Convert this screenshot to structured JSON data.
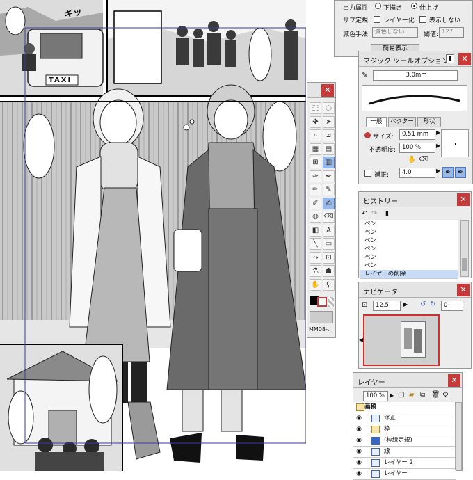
{
  "artboard": {
    "taxi_sign": "TAXI",
    "sfx": "キッ",
    "background_color": "#ffffff",
    "panel_border_color": "#000000",
    "guide_color": "#3a3aa8"
  },
  "property_panel": {
    "output_attr_label": "出力属性:",
    "output_draft": "下描き",
    "output_final": "仕上げ",
    "subtool_label": "サブ定規:",
    "layer_mode_label": "レイヤー化",
    "hide_label": "表示しない",
    "reduce_label": "減色手法:",
    "reduce_value": "減色しない",
    "threshold_label": "閾値:",
    "threshold_value": "127",
    "extra_button": "簡易表示"
  },
  "magic_tool": {
    "title": "マジック ツールオプション",
    "brush_size_value": "3.0mm",
    "tabs": [
      "一般",
      "ベクター",
      "形状"
    ],
    "size_label": "サイズ:",
    "size_value": "0.51 mm",
    "opacity_label": "不透明度:",
    "opacity_value": "100 %",
    "correct_label": "補正:",
    "correct_value": "4.0",
    "accent_color": "#c83a3a"
  },
  "toolbox": {
    "footer_label": "MM08-..."
  },
  "history": {
    "title": "ヒストリー",
    "items": [
      "ペン",
      "ペン",
      "ペン",
      "ペン",
      "ペン",
      "ペン",
      "レイヤーの削除"
    ]
  },
  "navigator": {
    "title": "ナビゲータ",
    "zoom_value": "12.5",
    "rotate_value": "0",
    "view_frame_color": "#d03030"
  },
  "layers": {
    "title": "レイヤー",
    "opacity_value": "100 %",
    "rows": [
      {
        "name": "画稿",
        "type": "folder"
      },
      {
        "name": "修正",
        "type": "layer"
      },
      {
        "name": "枠",
        "type": "folder"
      },
      {
        "name": "(枠線定規)",
        "type": "ruler"
      },
      {
        "name": "線",
        "type": "layer"
      },
      {
        "name": "レイヤー 2",
        "type": "layer"
      },
      {
        "name": "レイヤー",
        "type": "layer"
      }
    ]
  }
}
